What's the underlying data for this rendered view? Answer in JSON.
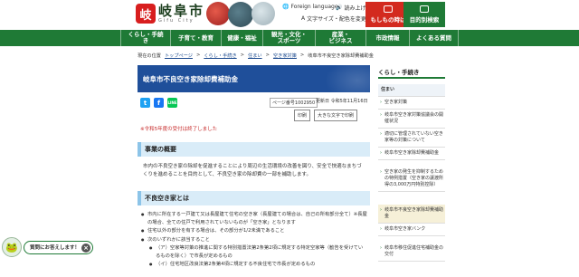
{
  "header": {
    "logo_mark": "岐",
    "logo_title": "岐阜市",
    "logo_sub": "Gifu City",
    "foreign_language": "Foreign language",
    "read_aloud": "読み上げ",
    "text_size_color": "文字サイズ・配色を変更",
    "emergency_label": "もしもの時は",
    "purpose_search_label": "目的別検索"
  },
  "nav": {
    "items": [
      "くらし・手続き",
      "子育て・教育",
      "健康・福祉",
      "観光・文化・\nスポーツ",
      "産業・\nビジネス",
      "市政情報",
      "よくある質問"
    ]
  },
  "breadcrumb": {
    "current_location": "現在の位置",
    "items": [
      "トップページ",
      "くらし・手続き",
      "住まい",
      "空き家対策",
      "岐阜市不良空き家除却費補助金"
    ]
  },
  "page": {
    "title": "岐阜市不良空き家除却費補助金",
    "page_id": "ページ番号1002950",
    "updated": "更新日 令和5年11月16日",
    "print_label": "印刷",
    "large_print_label": "大きな文字で印刷",
    "notice": "※令和5年度の受付は終了しました"
  },
  "share": {
    "twitter": "t",
    "facebook": "f",
    "line": "LINE"
  },
  "sections": {
    "overview_heading": "事業の概要",
    "overview_text": "市内の不良空き家の除却を促進することにより周辺の生活環境の改善を図り、安全で快適なまちづくりを進めることを目的として、不良空き家の除却費の一部を補助します。",
    "definition_heading": "不良空き家とは",
    "definition_items": [
      "市内に所在する一戸建て又は長屋建て住宅の空き家（長屋建ての場合は、自己の所有部分全て）※長屋の場合、全ての住戸で利用されていないものが「空き家」となります",
      "住宅以外の部分を有する場合は、その部分が1/2未満であること",
      "次のいずれかに該当すること",
      "（ア）空家等対策の推進に関する特別措置法第2条第2項に規定する特定空家等（勧告を受けているものを除く）で市長が定めるもの",
      "（イ）住宅地区改良法第2条第4項に規定する不良住宅で市長が定めるもの"
    ]
  },
  "sidebar": {
    "title": "くらし・手続き",
    "section": "住まい",
    "items": [
      "空き家対策",
      "岐阜市空き家対策協議会の開催状況",
      "適切に管理されていない空き家等の対策について",
      "岐阜市空き家除却費補助金",
      "空き家の発生を抑制するための特例措置（空き家の譲渡所得の3,000万円特別控除）",
      "岐阜市不良空き家除却費補助金",
      "岐阜市空き家バンク",
      "岐阜市移住促進住宅補助金の交付"
    ]
  },
  "chatbot": {
    "label": "質問にお答えします！",
    "close": "×"
  }
}
